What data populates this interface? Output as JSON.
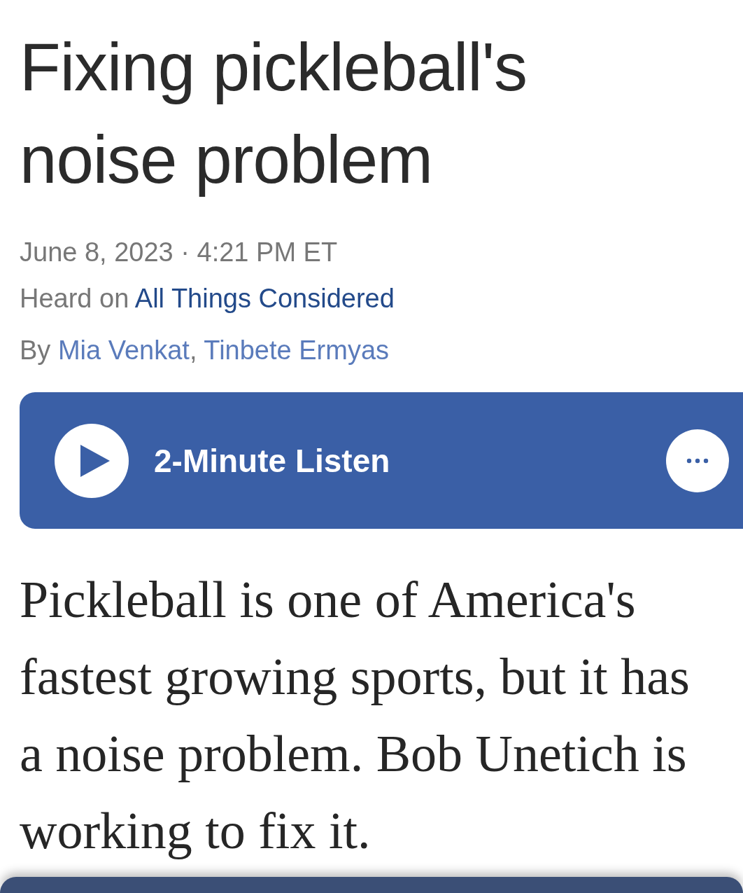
{
  "headline": "Fixing pickleball's noise problem",
  "dateline": "June 8, 2023 · 4:21 PM ET",
  "heard_on": {
    "prefix": "Heard on",
    "program": "All Things Considered"
  },
  "byline": {
    "prefix": "By",
    "separator": ",",
    "authors": [
      "Mia Venkat",
      "Tinbete Ermyas"
    ]
  },
  "player": {
    "label": "2-Minute Listen"
  },
  "body": "Pickleball is one of America's fastest growing sports, but it has a noise problem. Bob Unetich is working to fix it."
}
